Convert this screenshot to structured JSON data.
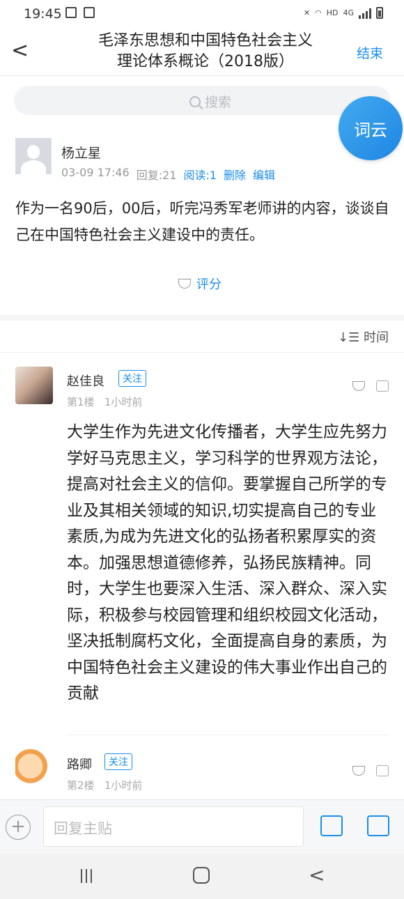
{
  "status": {
    "time": "19:45",
    "net": "HD",
    "gen": "4G"
  },
  "header": {
    "title_line1": "毛泽东思想和中国特色社会主义",
    "title_line2": "理论体系概论（2018版）",
    "end_label": "结束"
  },
  "search": {
    "placeholder": "搜索"
  },
  "cloud_button": "词云",
  "post": {
    "author": "杨立星",
    "date": "03-09 17:46",
    "replies": "回复:21",
    "reads": "阅读:1",
    "delete": "删除",
    "edit": "编辑",
    "body": "作为一名90后，00后，听完冯秀军老师讲的内容，谈谈自己在中国特色社会主义建设中的责任。",
    "rate": "评分"
  },
  "sort": {
    "label": "时间"
  },
  "comments": [
    {
      "name": "赵佳良",
      "follow": "关注",
      "floor": "第1楼",
      "time": "1小时前",
      "body": "大学生作为先进文化传播者，大学生应先努力学好马克思主义，学习科学的世界观方法论，提高对社会主义的信仰。要掌握自己所学的专业及其相关领域的知识,切实提高自己的专业素质,为成为先进文化的弘扬者积累厚实的资本。加强思想道德修养，弘扬民族精神。同时，大学生也要深入生活、深入群众、深入实际，积极参与校园管理和组织校园文化活动，坚决抵制腐朽文化，全面提高自身的素质，为中国特色社会主义建设的伟大事业作出自己的贡献"
    },
    {
      "name": "路卿",
      "follow": "关注",
      "floor": "第2楼",
      "time": "1小时前"
    }
  ],
  "reply": {
    "placeholder": "回复主贴"
  }
}
